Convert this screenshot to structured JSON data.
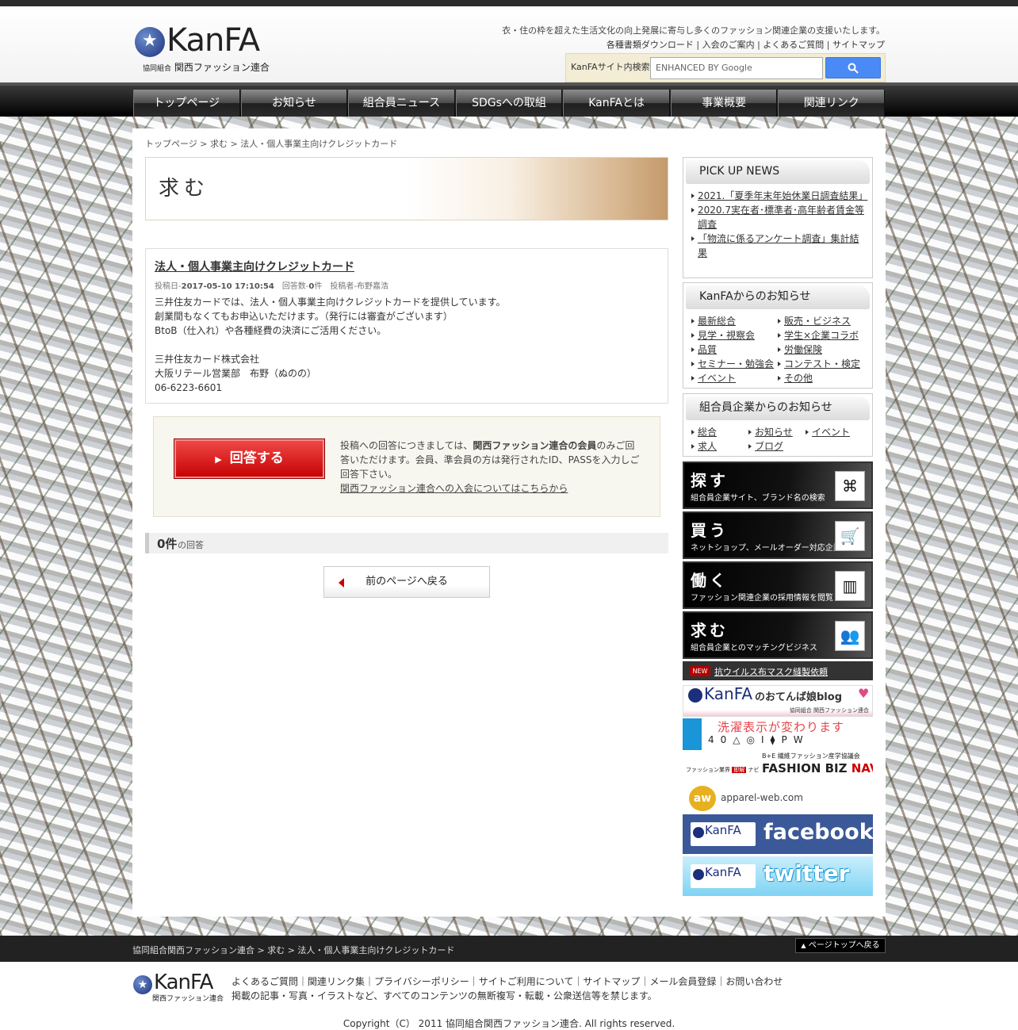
{
  "header": {
    "logo_text": "KanFA",
    "logo_sub_small": "協同組合",
    "logo_sub": "関西ファッション連合",
    "tagline": "衣・住の枠を超えた生活文化の向上発展に寄与し多くのファッション関連企業の支援いたします。",
    "links": [
      "各種書類ダウンロード",
      "入会のご案内",
      "よくあるご質問",
      "サイトマップ"
    ],
    "search_label": "KanFAサイト内検索",
    "search_placeholder": "ENHANCED BY Google",
    "search_icon": "search-icon"
  },
  "nav": [
    "トップページ",
    "お知らせ",
    "組合員ニュース",
    "SDGsへの取組",
    "KanFAとは",
    "事業概要",
    "関連リンク"
  ],
  "breadcrumb": [
    "トップページ",
    "求む",
    "法人・個人事業主向けクレジットカード"
  ],
  "banner_title": "求む",
  "post": {
    "title": "法人・個人事業主向けクレジットカード",
    "date_label": "投稿日-",
    "date": "2017-05-10 17:10:54",
    "answers_label": "回答数-",
    "answers": "0",
    "answers_unit": "件",
    "author_label": "投稿者-",
    "author": "布野嘉浩",
    "body": "三井住友カードでは、法人・個人事業主向けクレジットカードを提供しています。\n創業間もなくてもお申込いただけます。（発行には審査がございます）\nBtoB（仕入れ）や各種経費の決済にご活用ください。\n\n三井住友カード株式会社\n大阪リテール営業部　布野（ぬのの）\n06-6223-6601"
  },
  "answer_box": {
    "button": "回答する",
    "text_before": "投稿への回答につきましては、",
    "text_bold": "関西ファッション連合の会員",
    "text_after": "のみご回答いただけます。会員、準会員の方は発行されたID、PASSを入力しご回答下さい。",
    "link": "関西ファッション連合への入会についてはこちらから"
  },
  "answer_count": {
    "num": "0件",
    "label": "の回答"
  },
  "back_button": "前のページへ戻る",
  "sidebar": {
    "pickup": {
      "title": "PICK UP NEWS",
      "items": [
        "2021.「夏季年末年始休業日調査結果」",
        "2020.7実在者･標準者･高年齢者賃金等調査",
        "「物流に係るアンケート調査」集計結果"
      ]
    },
    "kanfa_news": {
      "title": "KanFAからのお知らせ",
      "items": [
        "最新総合",
        "販売・ビジネス",
        "見学・視察会",
        "学生×企業コラボ",
        "品質",
        "労働保険",
        "セミナー・勉強会",
        "コンテスト・検定",
        "イベント",
        "その他"
      ]
    },
    "member_news": {
      "title": "組合員企業からのお知らせ",
      "items": [
        "総合",
        "お知らせ",
        "イベント",
        "求人",
        "ブログ"
      ]
    },
    "buttons": [
      {
        "big": "探す",
        "small": "組合員企業サイト、ブランド名の検索",
        "icon": "binoculars-icon"
      },
      {
        "big": "買う",
        "small": "ネットショップ、メールオーダー対応企業",
        "icon": "cart-icon"
      },
      {
        "big": "働く",
        "small": "ファッション関連企業の採用情報を閲覧",
        "icon": "building-icon"
      },
      {
        "big": "求む",
        "small": "組合員企業とのマッチングビジネス",
        "icon": "people-icon"
      }
    ],
    "new_badge": "NEW",
    "new_text": "抗ウイルス布マスク縫製依頼",
    "banners": {
      "blog_logo": "KanFA",
      "blog_text": "のおてんば娘blog",
      "blog_sub": "協同組合 関西ファッション連合",
      "wash_text": "洗濯表示が変わります",
      "wash_icons": [
        "40",
        "△",
        "◎",
        "Ⅰ",
        "⧫",
        "P",
        "W"
      ],
      "fb_top": "B+E 繊維ファッション産学協議会",
      "fb_left": "ファッション業界",
      "fb_mid": "即解",
      "fb_navi": "ナビ",
      "fb_main": "FASHION BIZ",
      "fb_navi2": "NAVI",
      "aw_badge": "aw",
      "aw_text": "apparel-web.com",
      "facebook_logo": "KanFA",
      "facebook_text": "facebook",
      "twitter_logo": "KanFA",
      "twitter_text": "twitter"
    }
  },
  "footer": {
    "breadcrumb": "協同組合関西ファッション連合 > 求む > 法人・個人事業主向けクレジットカード",
    "pagetop": "ページトップへ戻る",
    "logo_text": "KanFA",
    "logo_sub": "関西ファッション連合",
    "links": "よくあるご質問｜関連リンク集｜プライバシーポリシー｜サイトご利用について｜サイトマップ｜メール会員登録｜お問い合わせ",
    "note": "掲載の記事・写真・イラストなど、すべてのコンテンツの無断複写・転載・公衆送信等を禁じます。",
    "copyright": "Copyright（C） 2011 協同組合関西ファッション連合. All rights reserved."
  }
}
